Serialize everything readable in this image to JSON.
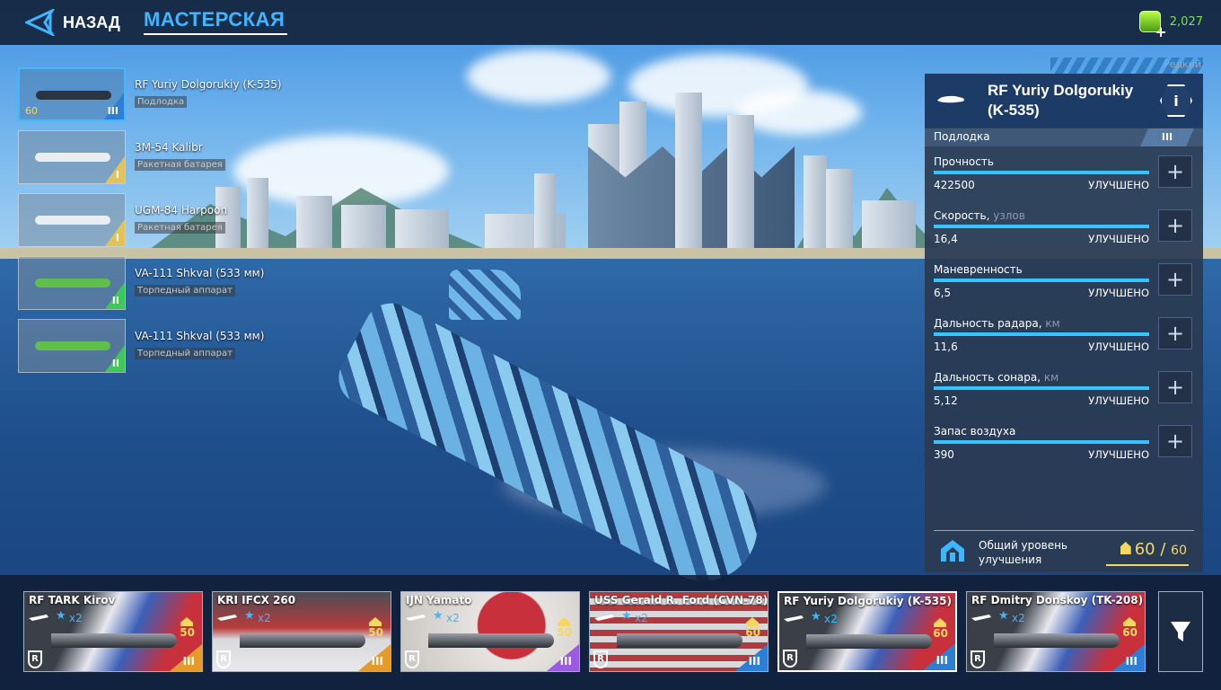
{
  "topbar": {
    "back_label": "НАЗАД",
    "title": "МАСТЕРСКАЯ",
    "currency_value": "2,027",
    "icons": {
      "back": "back-arrow-icon",
      "currency": "premium-currency-icon"
    }
  },
  "loadout": [
    {
      "name": "RF Yuriy Dolgorukiy (K-535)",
      "type": "Подлодка",
      "tier": "III",
      "level": "60",
      "selected": true,
      "color": "#2d7fd6"
    },
    {
      "name": "3M-54 Kalibr",
      "type": "Ракетная батарея",
      "tier": "I",
      "color": "#e2c35a"
    },
    {
      "name": "UGM-84 Harpoon",
      "type": "Ракетная батарея",
      "tier": "I",
      "color": "#e2c35a"
    },
    {
      "name": "VA-111 Shkval (533 мм)",
      "type": "Торпедный аппарат",
      "tier": "II",
      "color": "#3fc85a"
    },
    {
      "name": "VA-111 Shkval (533 мм)",
      "type": "Торпедный аппарат",
      "tier": "II",
      "color": "#3fc85a"
    }
  ],
  "panel": {
    "rarity": "Редкий",
    "ship_name": "RF Yuriy Dolgorukiy (K-535)",
    "class": "Подлодка",
    "tier": "III",
    "info_label": "i",
    "upgrade_status": "УЛУЧШЕНО",
    "plus_label": "+",
    "stats": [
      {
        "name": "Прочность",
        "unit": "",
        "value": "422500"
      },
      {
        "name": "Скорость,",
        "unit": "узлов",
        "value": "16,4"
      },
      {
        "name": "Маневренность",
        "unit": "",
        "value": "6,5"
      },
      {
        "name": "Дальность радара,",
        "unit": "км",
        "value": "11,6"
      },
      {
        "name": "Дальность сонара,",
        "unit": "км",
        "value": "5,12"
      },
      {
        "name": "Запас воздуха",
        "unit": "",
        "value": "390"
      }
    ],
    "total_label": "Общий уровень улучшения",
    "total_current": "60",
    "total_separator": "/",
    "total_max": "60"
  },
  "fleet": [
    {
      "name": "RF TARK Kirov",
      "stars": "x2",
      "level": "50",
      "tier": "III",
      "badge": "R",
      "tier_color": "#e59a2a",
      "flag": "russia"
    },
    {
      "name": "KRI IFCX 260",
      "stars": "x2",
      "level": "50",
      "tier": "III",
      "badge": "R",
      "tier_color": "#e59a2a",
      "flag": "indonesia"
    },
    {
      "name": "IJN Yamato",
      "stars": "x2",
      "level": "50",
      "tier": "III",
      "badge": "R",
      "tier_color": "#9b5be0",
      "flag": "japan"
    },
    {
      "name": "USS Gerald R. Ford (CVN-78)",
      "stars": "x2",
      "level": "60",
      "tier": "III",
      "badge": "R",
      "tier_color": "#2d7fd6",
      "flag": "usa"
    },
    {
      "name": "RF Yuriy Dolgorukiy (K-535)",
      "stars": "x2",
      "level": "60",
      "tier": "III",
      "badge": "R",
      "tier_color": "#2d7fd6",
      "flag": "russia",
      "selected": true
    },
    {
      "name": "RF Dmitry Donskoy (TK-208)",
      "stars": "x2",
      "level": "60",
      "tier": "III",
      "badge": "R",
      "tier_color": "#2d7fd6",
      "flag": "russia"
    }
  ],
  "filter": {
    "icon": "filter-funnel-icon"
  }
}
